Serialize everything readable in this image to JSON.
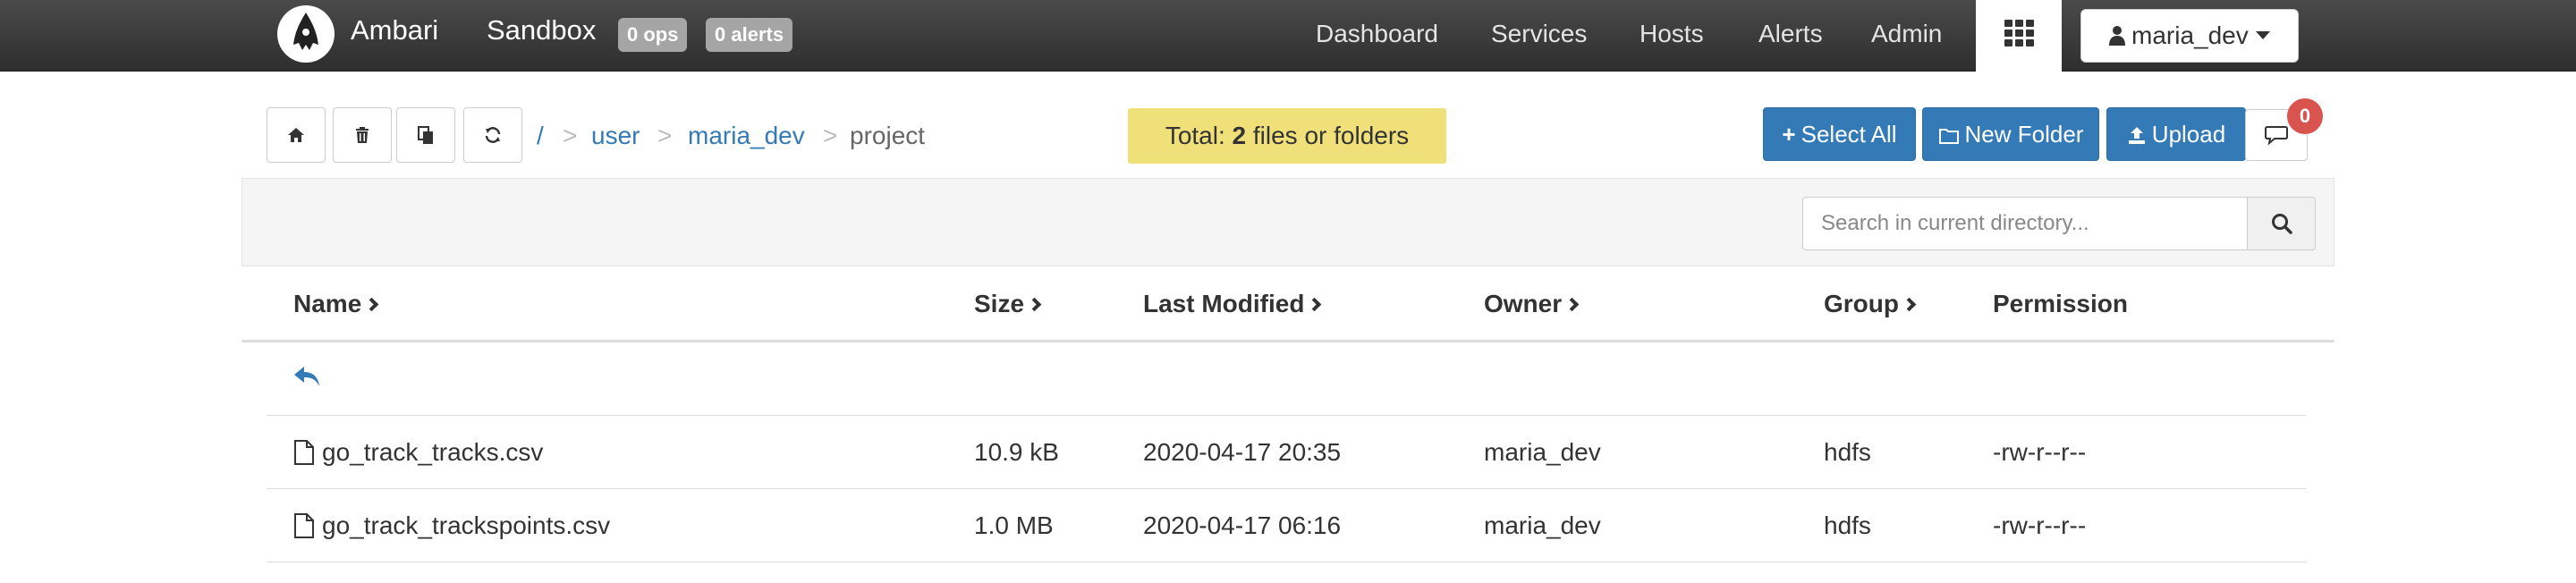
{
  "topbar": {
    "brand": "Ambari",
    "cluster": "Sandbox",
    "ops_badge": "0 ops",
    "alerts_badge": "0 alerts",
    "nav": [
      "Dashboard",
      "Services",
      "Hosts",
      "Alerts",
      "Admin"
    ],
    "user": "maria_dev"
  },
  "breadcrumb": {
    "root": "/",
    "separator": ">",
    "items": [
      "user",
      "maria_dev",
      "project"
    ]
  },
  "summary": {
    "prefix": "Total: ",
    "count": "2",
    "suffix": " files or folders"
  },
  "actions": {
    "select_all": "Select All",
    "new_folder": "New Folder",
    "upload": "Upload",
    "message_count": "0"
  },
  "search": {
    "placeholder": "Search in current directory..."
  },
  "table": {
    "columns": [
      "Name",
      "Size",
      "Last Modified",
      "Owner",
      "Group",
      "Permission"
    ],
    "rows": [
      {
        "name": "go_track_tracks.csv",
        "size": "10.9 kB",
        "modified": "2020-04-17 20:35",
        "owner": "maria_dev",
        "group": "hdfs",
        "permission": "-rw-r--r--"
      },
      {
        "name": "go_track_trackspoints.csv",
        "size": "1.0 MB",
        "modified": "2020-04-17 06:16",
        "owner": "maria_dev",
        "group": "hdfs",
        "permission": "-rw-r--r--"
      }
    ]
  },
  "colors": {
    "primary": "#337ab7",
    "summary_bg": "#f0e07a",
    "badge": "#d9534f",
    "topbar": "#3a3a3a"
  }
}
